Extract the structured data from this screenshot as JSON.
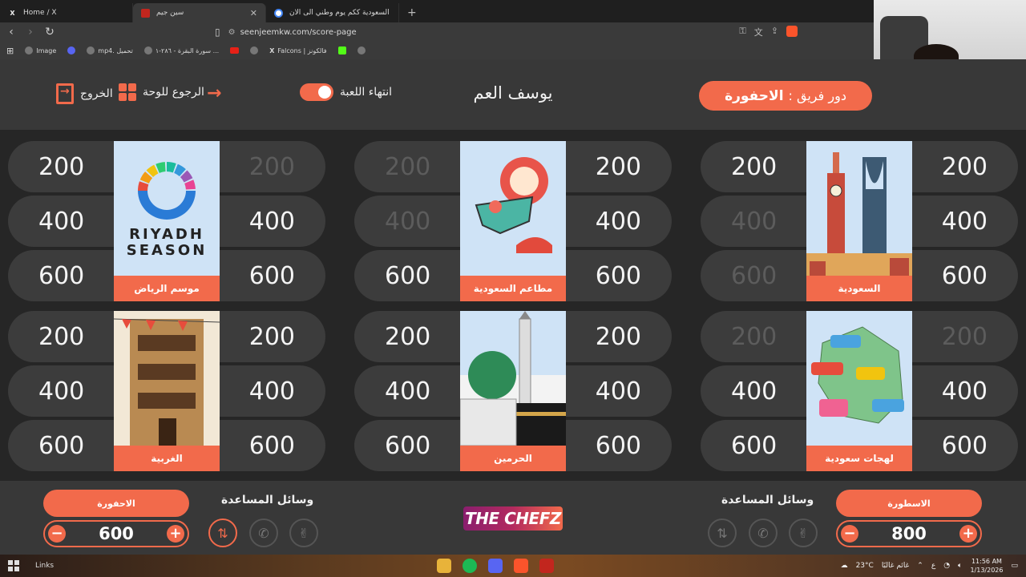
{
  "browser": {
    "tabs": [
      {
        "label": "Home / X",
        "icon": "x-logo-icon"
      },
      {
        "label": "سين جيم",
        "icon": "site-icon"
      },
      {
        "label": "السعودية ككم يوم وطني الى الان - rch",
        "icon": "google-icon"
      }
    ],
    "url": "seenjeemkw.com/score-page",
    "bookmarks": [
      "Image",
      "mp4. تحميل",
      "سورة البقرة - ٢٨٦-١ ...",
      "Falcons | فالكونز"
    ]
  },
  "header": {
    "turn_label": "دور فريق :",
    "turn_team": "الاحفورة",
    "title": "يوسف العم",
    "end_game": "انتهاء اللعبة",
    "back_to_board": "الرجوع للوحة",
    "exit": "الخروج"
  },
  "board": {
    "groups": [
      {
        "category": "السعودية",
        "left": [
          "200",
          "400",
          "600"
        ],
        "right": [
          "200",
          "400",
          "600"
        ],
        "left_used": [
          false,
          true,
          true
        ],
        "right_used": [
          false,
          false,
          false
        ]
      },
      {
        "category": "مطاعم السعودية",
        "left": [
          "200",
          "400",
          "600"
        ],
        "right": [
          "200",
          "400",
          "600"
        ],
        "left_used": [
          true,
          true,
          false
        ],
        "right_used": [
          false,
          false,
          false
        ]
      },
      {
        "category": "موسم الرياض",
        "left": [
          "200",
          "400",
          "600"
        ],
        "right": [
          "200",
          "400",
          "600"
        ],
        "left_used": [
          false,
          false,
          false
        ],
        "right_used": [
          true,
          false,
          false
        ]
      },
      {
        "category": "لهجات سعودية",
        "left": [
          "200",
          "400",
          "600"
        ],
        "right": [
          "200",
          "400",
          "600"
        ],
        "left_used": [
          true,
          false,
          false
        ],
        "right_used": [
          true,
          false,
          false
        ]
      },
      {
        "category": "الحرمين",
        "left": [
          "200",
          "400",
          "600"
        ],
        "right": [
          "200",
          "400",
          "600"
        ],
        "left_used": [
          false,
          false,
          false
        ],
        "right_used": [
          false,
          false,
          false
        ]
      },
      {
        "category": "الغربية",
        "left": [
          "200",
          "400",
          "600"
        ],
        "right": [
          "200",
          "400",
          "600"
        ],
        "left_used": [
          false,
          false,
          false
        ],
        "right_used": [
          false,
          false,
          false
        ]
      }
    ],
    "riyadh_logo_line1": "RIYADH",
    "riyadh_logo_line2": "SEASON"
  },
  "footer": {
    "aids_label": "وسائل المساعدة",
    "left_team": {
      "name": "الاحفورة",
      "score": "600"
    },
    "right_team": {
      "name": "الاسطورة",
      "score": "800"
    },
    "logo": "THE CHEFZ",
    "minus": "−",
    "plus": "+"
  },
  "taskbar": {
    "links": "Links",
    "weather": "23°C",
    "weather_text": "غائم غالبًا",
    "lang": "ع",
    "time": "11:56 AM",
    "date": "1/13/2026"
  },
  "colors": {
    "accent": "#f26a4b",
    "panel": "#383838",
    "background": "#262626",
    "cell": "#3c3c3c"
  }
}
